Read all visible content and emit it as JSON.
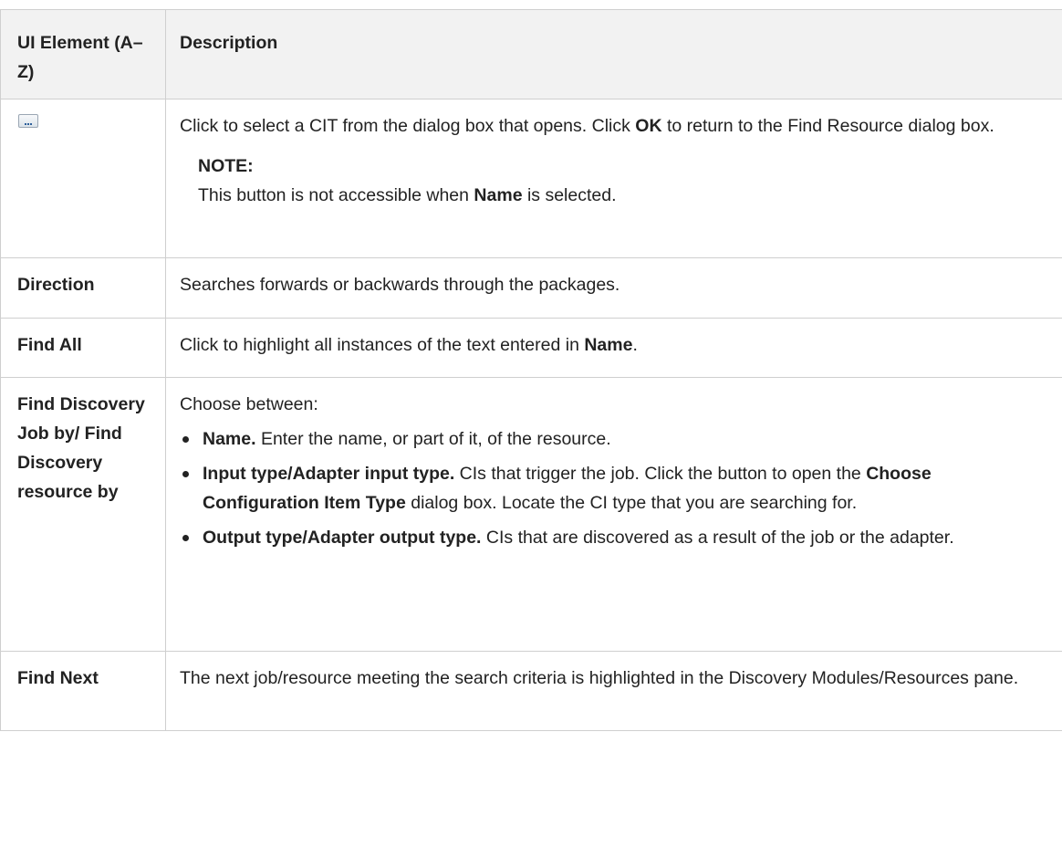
{
  "header": {
    "col1": "UI Element (A–Z)",
    "col2": "Description"
  },
  "rows": {
    "ellipsis": {
      "icon": "ellipsis-button-icon",
      "desc_part1": "Click to select a CIT from the dialog box that opens. Click ",
      "desc_bold1": "OK",
      "desc_part2": " to return to the Find Resource dialog box.",
      "note_title": "NOTE:",
      "note_part1": "This button is not accessible when ",
      "note_bold": "Name",
      "note_part2": " is selected."
    },
    "direction": {
      "label": "Direction",
      "desc": "Searches forwards or backwards through the packages."
    },
    "find_all": {
      "label": "Find All",
      "desc_part1": "Click to highlight all instances of the text entered in ",
      "desc_bold": "Name",
      "desc_part2": "."
    },
    "find_discovery": {
      "label": "Find Discovery Job by/ Find Discovery resource by",
      "intro": "Choose between:",
      "options": [
        {
          "bold": "Name.",
          "text": " Enter the name, or part of it, of the resource."
        },
        {
          "bold": "Input type/Adapter input type.",
          "text": " CIs that trigger the job. Click the button to open the ",
          "bold2": "Choose Configuration Item Type",
          "text2": " dialog box. Locate the CI type that you are searching for."
        },
        {
          "bold": "Output type/Adapter output type.",
          "text": " CIs that are discovered as a result of the job or the adapter."
        }
      ]
    },
    "find_next": {
      "label": "Find Next",
      "desc": "The next job/resource meeting the search criteria is highlighted in the Discovery Modules/Resources pane."
    }
  }
}
